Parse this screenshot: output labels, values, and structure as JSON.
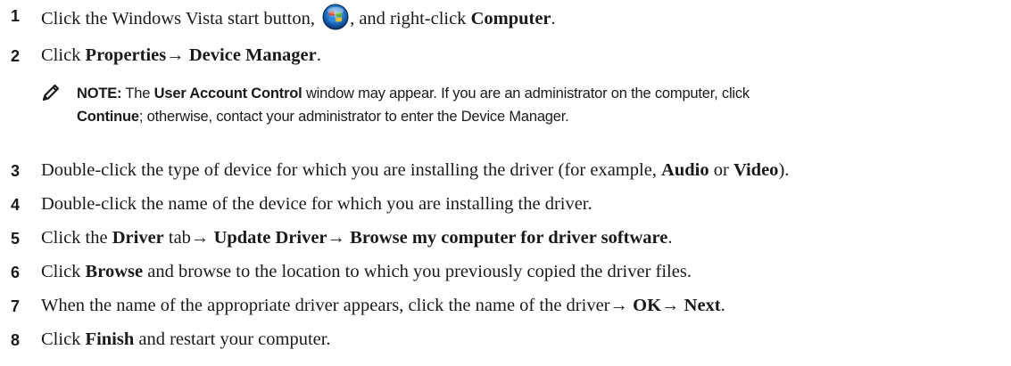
{
  "steps": [
    {
      "num": "1",
      "before_icon": "Click the Windows Vista start button, ",
      "icon": "windows-vista-start-icon",
      "after_icon": ", and right-click ",
      "bold": "Computer",
      "end": "."
    },
    {
      "num": "2",
      "pre": "Click ",
      "bold1": "Properties",
      "arrow": "→ ",
      "bold2": "Device Manager",
      "end": "."
    },
    {
      "num": "3",
      "pre": "Double-click the type of device for which you are installing the driver (for example, ",
      "bold1": "Audio",
      "mid": " or ",
      "bold2": "Video",
      "end": ")."
    },
    {
      "num": "4",
      "text": "Double-click the name of the device for which you are installing the driver."
    },
    {
      "num": "5",
      "pre": "Click the ",
      "bold1": "Driver",
      "mid1": " tab→ ",
      "bold2": "Update Driver",
      "mid2": "→ ",
      "bold3": "Browse my computer for driver software",
      "end": "."
    },
    {
      "num": "6",
      "pre": "Click ",
      "bold1": "Browse",
      "end": " and browse to the location to which you previously copied the driver files."
    },
    {
      "num": "7",
      "pre": "When the name of the appropriate driver appears, click the name of the driver→ ",
      "bold1": "OK",
      "mid": "→ ",
      "bold2": "Next",
      "end": "."
    },
    {
      "num": "8",
      "pre": "Click ",
      "bold1": "Finish",
      "end": " and restart your computer."
    }
  ],
  "note": {
    "icon": "pencil-note-icon",
    "label": "NOTE:",
    "line1_a": " The ",
    "line1_bold": "User Account Control",
    "line1_b": " window may appear. If you are an administrator on the computer, click",
    "line2_bold": "Continue",
    "line2_b": "; otherwise, contact your administrator to enter the Device Manager."
  },
  "colors": {
    "text": "#1a1a1a",
    "vista_orb_blue": "#1e6fc4",
    "flag_red": "#e8452c",
    "flag_green": "#5cb531",
    "flag_blue": "#2a8be0",
    "flag_yellow": "#f5c21a"
  }
}
